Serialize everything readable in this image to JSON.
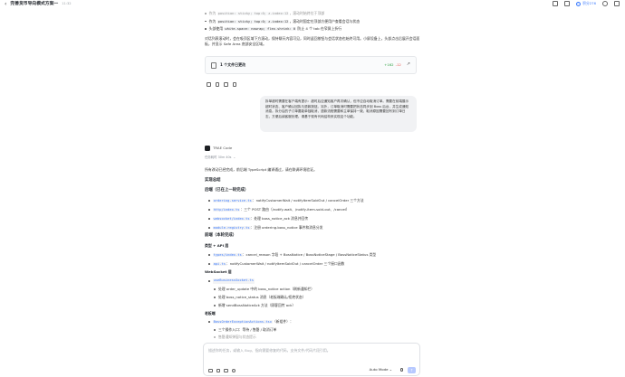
{
  "window": {
    "back_glyph": "‹",
    "title": "完善货币导向模式方案一",
    "time": "11:32",
    "credits": "积分276"
  },
  "intro": {
    "lines": [
      {
        "pre": "作为 ",
        "code": "position: sticky; top:0; z-index:12",
        "post": "，滚动时始终位于顶部"
      },
      {
        "pre": "作为 ",
        "code": "position: sticky; top:0; z-index:12",
        "post": "，滚动时固定在顶部方便用户查看会话与状态"
      },
      {
        "pre": "头部使用 ",
        "code": "white-space: nowrap; flex-shrink: 0",
        "post": " 防止 4 个 tab 在窄屏上折行"
      }
    ],
    "paragraph": "对话列表滚动时，会在吸顶区域下方滚动，保持聊天内容可见，同时返回按钮与会话状态也始终可用。小屏设备上，头部点击后展开会话面板，并显示 Safe Area 底部安全区域。"
  },
  "file_card": {
    "label": "1 个文件已更改",
    "additions": "+162",
    "deletions": "-12",
    "arrow": "↗"
  },
  "user_message": "拆单超时需要在客户端有提示：超时后应通知客户再次确认，但不应自动取消订单。需要在前端展示超时状态、客户确认回执与退款按钮。另外，订单取消时需要把状态同步到 Boss 后台，并生成通知消息。拆分后的子订单要能单独取消，退款流程需要和主单保持一致，取消原因需要回写到订单日志，方便后续客服处理。请基于现有代码结构来实现这个功能。",
  "bot": {
    "name": "TRAE Code",
    "status": "任务耗时 30m 40s",
    "summary": "所有改动已经完成，前后端 TypeScript 编译通过，请在联调环境验证。"
  },
  "report": {
    "title": "实现总结",
    "section1": "后端（已在上一轮完成）",
    "backend_items": [
      {
        "file": "ordering-service.ts",
        "desc": "：notifyCustomerWait / notifyItemSoldOut / cancelOrder 三个方法"
      },
      {
        "file": "http/index.ts",
        "desc": "：三个 POST 路由（/notify-wait、/notify-item-sold-out、/cancel）"
      },
      {
        "file": "websocket/index.ts",
        "desc": "：处理 boss_notice_ack 消息并回传"
      },
      {
        "file": "module-registry.ts",
        "desc": "：注册 ordering.boss_notice 事件和消息分发"
      }
    ],
    "section2": "前端（本轮完成）",
    "sub1": "类型 + API 层",
    "frontend_items": [
      {
        "file": "types/index.ts",
        "desc": "：cancel_reason 字段 + BossNotice / BossNoticeStage / BossNoticeStatus 类型"
      },
      {
        "file": "api.ts",
        "desc": "：notifyCustomerWait / notifyItemSoldOut / cancelOrder 三个接口函数"
      }
    ],
    "sub2": "WebSocket 层",
    "ws_file": "useBusinessSocket.ts",
    "ws_items": [
      "处理 order_update 中的 boss_notice action（刷新通知栏）",
      "处理 boss_notice_status 消息（老板端确认/拒绝状态）",
      "新增 sendBossNoticeAck 方法（顾客回传 ack）"
    ],
    "sub3": "老板端",
    "boss_file": "BossOrderExceptionActions.tsx",
    "boss_file_note": "（新组件）：",
    "boss_items": [
      "三个操作入口：等待 / 售罄 / 取消订单",
      "售罄通知弹窗与状态提示"
    ]
  },
  "composer": {
    "placeholder": "描述你的任务，或输入 Bug、指向需要修复的代码，支持文件/代码片段引用。",
    "mode": "Auto Mode ⌄",
    "send": "↑"
  }
}
